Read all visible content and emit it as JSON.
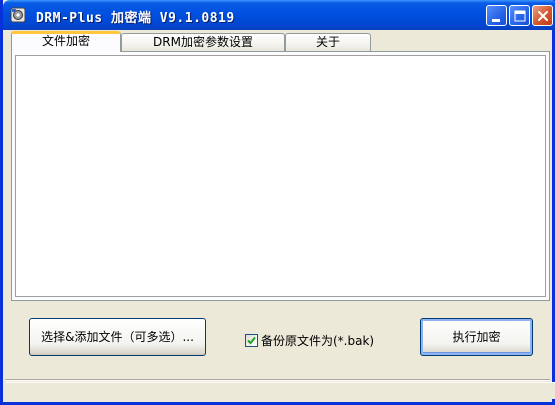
{
  "window": {
    "title": "DRM-Plus 加密端 V9.1.0819"
  },
  "tabs": [
    {
      "label": "文件加密"
    },
    {
      "label": "DRM加密参数设置"
    },
    {
      "label": "关于"
    }
  ],
  "actions": {
    "select_files_label": "选择&添加文件（可多选）...",
    "backup_label": "备份原文件为(*.bak)",
    "backup_checked": true,
    "encrypt_label": "执行加密"
  },
  "icons": {
    "app": "app-icon",
    "minimize": "minimize-icon",
    "maximize": "maximize-icon",
    "close": "close-icon",
    "checkmark": "checkmark-icon"
  },
  "colors": {
    "titlebar": "#0050e0",
    "active_tab_accent": "#ffc83c",
    "close_button": "#d4572f",
    "window_bg": "#ece9d8"
  }
}
